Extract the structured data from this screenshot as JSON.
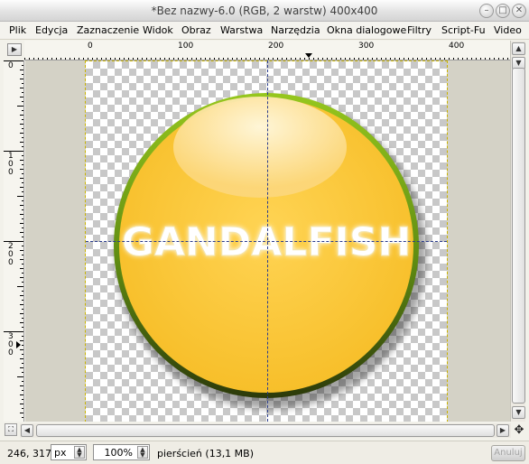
{
  "window": {
    "title": "*Bez nazwy-6.0 (RGB, 2 warstw) 400x400",
    "controls": {
      "minimize": "–",
      "maximize": "□",
      "close": "✕"
    }
  },
  "menu": [
    "Plik",
    "Edycja",
    "Zaznaczenie",
    "Widok",
    "Obraz",
    "Warstwa",
    "Narzędzia",
    "Okna dialogowe",
    "Filtry",
    "Script-Fu",
    "Video"
  ],
  "rulers": {
    "horizontal_labels": [
      "0",
      "100",
      "200",
      "300",
      "400"
    ],
    "vertical_labels": [
      "0",
      "100",
      "200",
      "300"
    ]
  },
  "canvas": {
    "artwork_text": "GANDALFISH",
    "colors": {
      "orb_fill": "#f6c029",
      "orb_rim": "#6ea619",
      "orb_shadow": "#3a4010",
      "guide": "#2a3c8c"
    }
  },
  "status": {
    "coords": "246, 317",
    "unit": "px",
    "zoom": "100%",
    "message": "pierścień (13,1 MB)",
    "cancel_label": "Anuluj"
  },
  "icons": {
    "nav": "✥",
    "zoom_fit": "⛶",
    "menu_arrow": "▶"
  }
}
